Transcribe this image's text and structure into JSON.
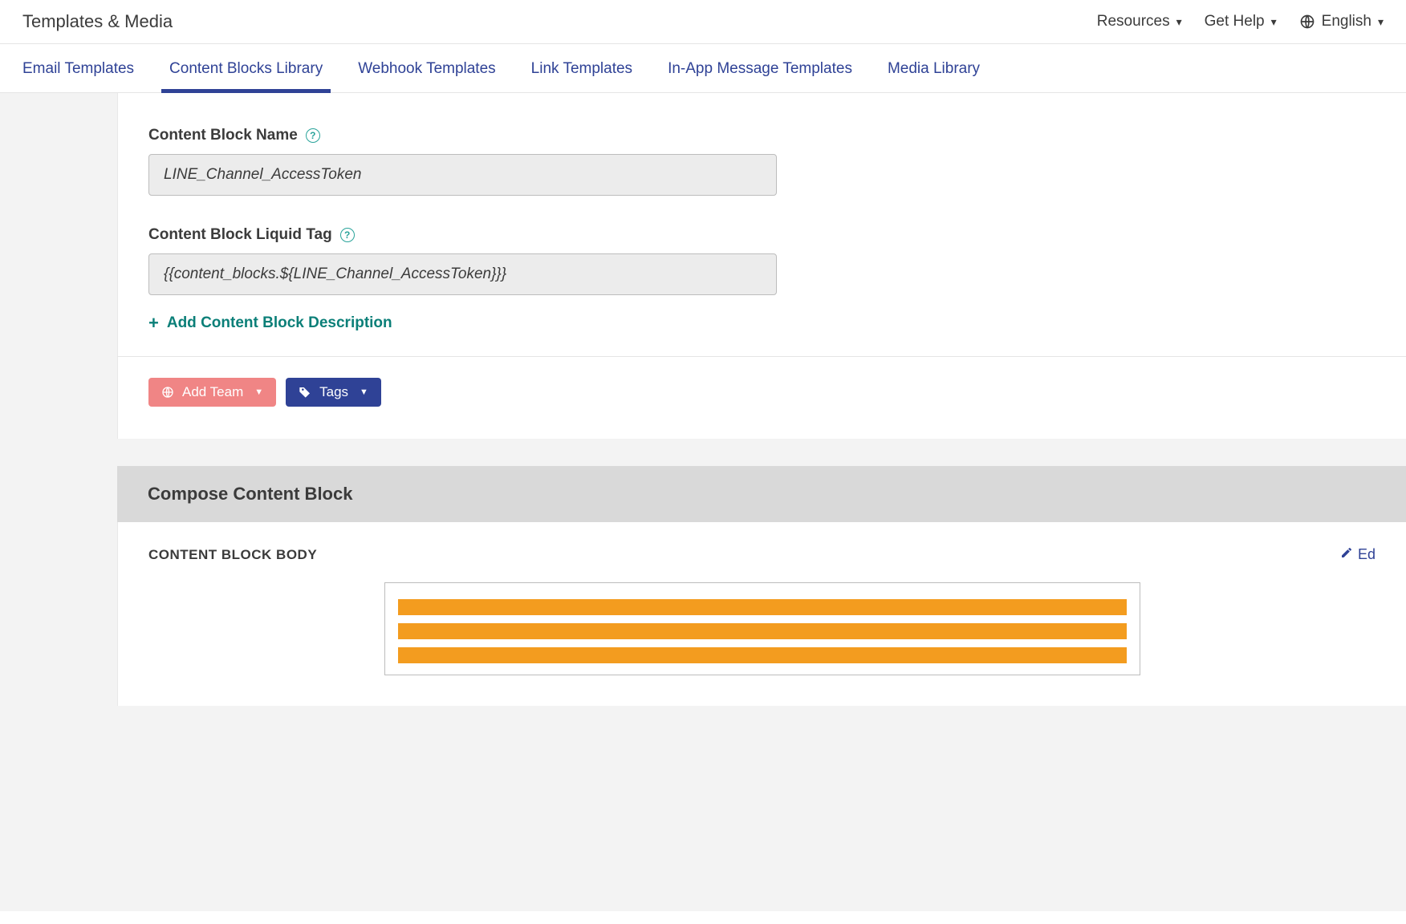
{
  "header": {
    "title": "Templates & Media",
    "links": {
      "resources": "Resources",
      "get_help": "Get Help",
      "language": "English"
    }
  },
  "tabs": [
    {
      "label": "Email Templates",
      "active": false
    },
    {
      "label": "Content Blocks Library",
      "active": true
    },
    {
      "label": "Webhook Templates",
      "active": false
    },
    {
      "label": "Link Templates",
      "active": false
    },
    {
      "label": "In-App Message Templates",
      "active": false
    },
    {
      "label": "Media Library",
      "active": false
    }
  ],
  "form": {
    "name_label": "Content Block Name",
    "name_value": "LINE_Channel_AccessToken",
    "liquid_label": "Content Block Liquid Tag",
    "liquid_value": "{{content_blocks.${LINE_Channel_AccessToken}}}",
    "add_description": "Add Content Block Description"
  },
  "toolbar": {
    "add_team": "Add Team",
    "tags": "Tags"
  },
  "compose": {
    "heading": "Compose Content Block",
    "body_label": "CONTENT BLOCK BODY",
    "edit_label": "Ed"
  }
}
